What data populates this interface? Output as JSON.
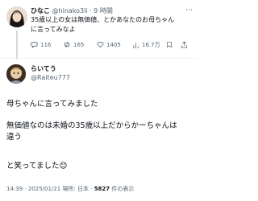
{
  "post1": {
    "display_name": "ひなこ",
    "handle": "@hinako3li",
    "time": "9 時間",
    "text_line1": "35歳以上の女は無価値、とかあなたのお母ちゃん",
    "text_line2": "に言ってみなよ",
    "replies": "116",
    "reposts": "165",
    "likes": "1405",
    "views": "16.7万"
  },
  "post2": {
    "display_name": "らいてう",
    "handle": "@Raiteu777",
    "line1": "母ちゃんに言ってみました",
    "line2": "無価値なのは未婚の35歳以上だからかーちゃんは",
    "line3": "違う",
    "line4": "と笑ってました😊",
    "meta_prefix": "14:39 · 2025/01/21 場所: 日本 · ",
    "views_count": "5827",
    "views_label": " 件の表示"
  }
}
